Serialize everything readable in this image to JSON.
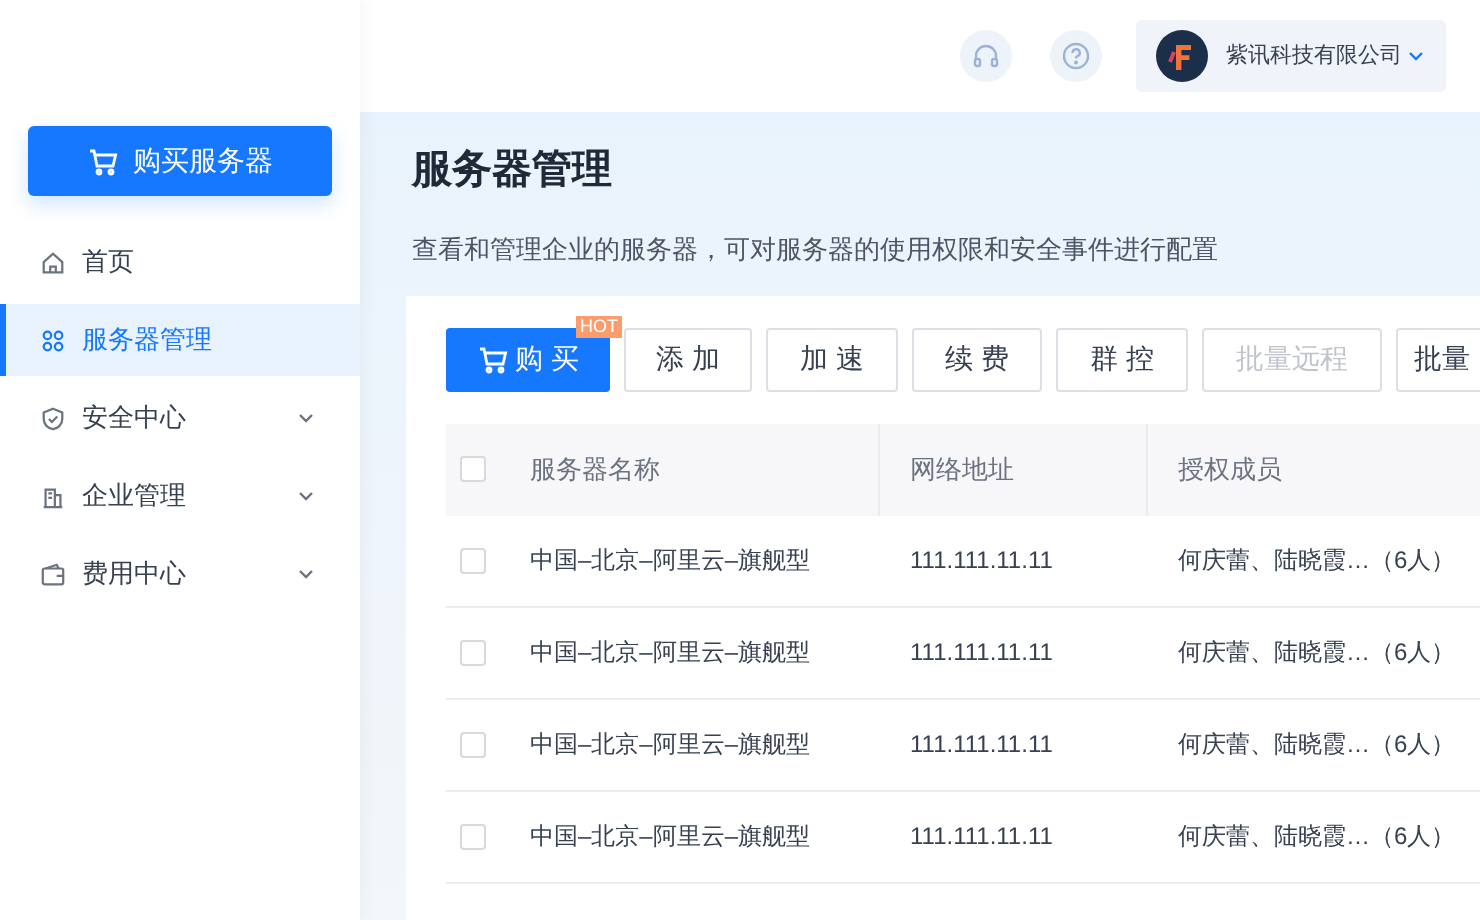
{
  "header": {
    "company": {
      "name": "紫讯科技有限公司"
    }
  },
  "sidebar": {
    "buy_button": {
      "label": "购买服务器"
    },
    "items": [
      {
        "label": "首页",
        "selected": false,
        "expandable": false,
        "kind": "home"
      },
      {
        "label": "服务器管理",
        "selected": true,
        "expandable": false,
        "kind": "grid"
      },
      {
        "label": "安全中心",
        "selected": false,
        "expandable": true,
        "kind": "shield"
      },
      {
        "label": "企业管理",
        "selected": false,
        "expandable": true,
        "kind": "building"
      },
      {
        "label": "费用中心",
        "selected": false,
        "expandable": true,
        "kind": "wallet"
      }
    ]
  },
  "page": {
    "title": "服务器管理",
    "description": "查看和管理企业的服务器，可对服务器的使用权限和安全事件进行配置"
  },
  "toolbar": {
    "buttons": [
      {
        "label": "购 买",
        "kind": "primary",
        "badge": "HOT",
        "disabled": false
      },
      {
        "label": "添 加",
        "kind": "default",
        "disabled": false
      },
      {
        "label": "加 速",
        "kind": "default",
        "disabled": false
      },
      {
        "label": "续 费",
        "kind": "default",
        "disabled": false
      },
      {
        "label": "群 控",
        "kind": "default",
        "disabled": false
      },
      {
        "label": "批量远程",
        "kind": "default",
        "disabled": true
      },
      {
        "label": "批量",
        "kind": "default",
        "disabled": false
      }
    ]
  },
  "table": {
    "header_checked": false,
    "columns": [
      "服务器名称",
      "网络地址",
      "授权成员"
    ],
    "rows": [
      {
        "checked": false,
        "cells": [
          "中国–北京–阿里云–旗舰型",
          "111.111.11.11",
          "何庆蕾、陆晓霞…（6人）"
        ]
      },
      {
        "checked": false,
        "cells": [
          "中国–北京–阿里云–旗舰型",
          "111.111.11.11",
          "何庆蕾、陆晓霞…（6人）"
        ]
      },
      {
        "checked": false,
        "cells": [
          "中国–北京–阿里云–旗舰型",
          "111.111.11.11",
          "何庆蕾、陆晓霞…（6人）"
        ]
      },
      {
        "checked": false,
        "cells": [
          "中国–北京–阿里云–旗舰型",
          "111.111.11.11",
          "何庆蕾、陆晓霞…（6人）"
        ]
      }
    ]
  }
}
